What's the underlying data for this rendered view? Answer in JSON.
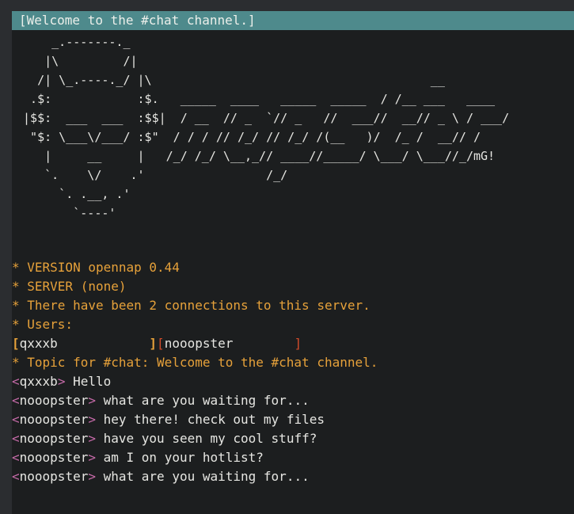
{
  "topic_bar": "[Welcome to the #chat channel.]",
  "ascii_art": "     _.-------._\n    |\\         /|\n   /| \\_.----._/ |\\                                       __\n  .$:            :$.   _____  ____   _____  _____  / /__ ___   ____\n |$$:  ___  ___  :$$|  / __  // _  `// _   //  ___//  __// _ \\ / ___/\n  \"$: \\___\\/___/ :$\"  / / / // /_/ // /_/ /(__   )/  /_ /  __// /\n    |     __     |   /_/ /_/ \\__,_// ____//_____/ \\___/ \\___//_/mG!\n    `.    \\/    .'                 /_/\n      `. .__, .'\n        `----'",
  "log": {
    "version": "* VERSION opennap 0.44",
    "server": "* SERVER (none)",
    "connections": "* There have been 2 connections to this server.",
    "users_label": "* Users:",
    "users": [
      "qxxxb",
      "nooopster"
    ],
    "topic_line": "* Topic for #chat: Welcome to the #chat channel.",
    "messages": [
      {
        "nick": "qxxxb",
        "text": "Hello"
      },
      {
        "nick": "nooopster",
        "text": "what are you waiting for..."
      },
      {
        "nick": "nooopster",
        "text": "hey there! check out my files"
      },
      {
        "nick": "nooopster",
        "text": "have you seen my cool stuff?"
      },
      {
        "nick": "nooopster",
        "text": "am I on your hotlist?"
      },
      {
        "nick": "nooopster",
        "text": "what are you waiting for..."
      }
    ]
  },
  "colors": {
    "background": "#1c1e1f",
    "topic_bar": "#4e8a8c",
    "system_text": "#e6a13a",
    "nick_bracket": "#c56aa8"
  }
}
